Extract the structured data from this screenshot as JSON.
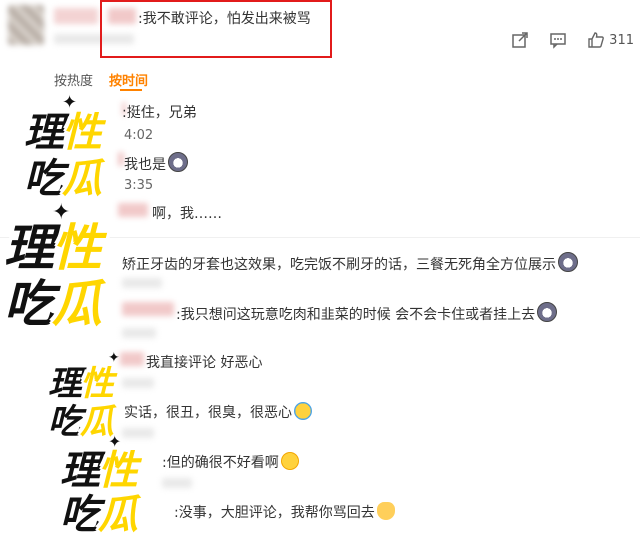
{
  "top_comment": {
    "text": ":我不敢评论，怕发出来被骂"
  },
  "actions": {
    "like_count": "311"
  },
  "tabs": [
    {
      "label": "按热度",
      "active": false
    },
    {
      "label": "按时间",
      "active": true
    }
  ],
  "replies": [
    {
      "text": ":挺住，兄弟",
      "time": "4:02"
    },
    {
      "text": "我也是",
      "time": "3:35",
      "emoji": "shock"
    },
    {
      "text": "啊，我……"
    },
    {
      "text": "矫正牙齿的牙套也这效果，吃完饭不刷牙的话，三餐无死角全方位展示",
      "emoji": "shock"
    },
    {
      "text": ":我只想问这玩意吃肉和韭菜的时候 会不会卡住或者挂上去",
      "emoji": "shock"
    },
    {
      "text": "我直接评论 好恶心"
    },
    {
      "text": "实话，很丑，很臭，很恶心",
      "emoji": "laugh"
    },
    {
      "text": ":但的确很不好看啊",
      "emoji": "cry"
    },
    {
      "text": ":没事，大胆评论，我帮你骂回去",
      "emoji": "cat"
    }
  ],
  "stickers": {
    "line1": {
      "a": "理",
      "b": "性"
    },
    "line2": {
      "a": "吃",
      "b": "瓜"
    }
  },
  "colors": {
    "highlight_box": "#e21b1b",
    "active_tab": "#ff8200",
    "sticker_yellow": "#ffd600"
  }
}
